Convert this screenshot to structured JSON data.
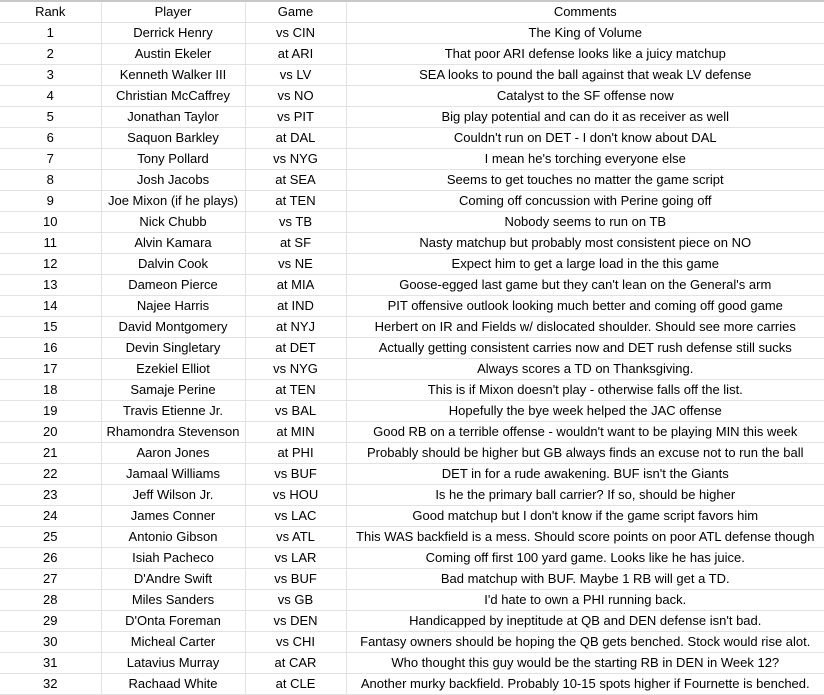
{
  "table": {
    "headers": {
      "rank": "Rank",
      "player": "Player",
      "game": "Game",
      "comments": "Comments"
    },
    "rows": [
      {
        "rank": "1",
        "player": "Derrick Henry",
        "game": "vs CIN",
        "comment": "The King of Volume"
      },
      {
        "rank": "2",
        "player": "Austin Ekeler",
        "game": "at ARI",
        "comment": "That poor ARI defense looks like a juicy matchup"
      },
      {
        "rank": "3",
        "player": "Kenneth Walker III",
        "game": "vs LV",
        "comment": "SEA looks to pound the ball against that weak LV defense"
      },
      {
        "rank": "4",
        "player": "Christian McCaffrey",
        "game": "vs NO",
        "comment": "Catalyst to the SF offense now"
      },
      {
        "rank": "5",
        "player": "Jonathan Taylor",
        "game": "vs PIT",
        "comment": "Big play potential and can do it as receiver as well"
      },
      {
        "rank": "6",
        "player": "Saquon Barkley",
        "game": "at DAL",
        "comment": "Couldn't run on DET - I don't know about DAL"
      },
      {
        "rank": "7",
        "player": "Tony Pollard",
        "game": "vs NYG",
        "comment": "I mean he's torching everyone else"
      },
      {
        "rank": "8",
        "player": "Josh Jacobs",
        "game": "at SEA",
        "comment": "Seems to get touches no matter the game script"
      },
      {
        "rank": "9",
        "player": "Joe Mixon (if he plays)",
        "game": "at TEN",
        "comment": "Coming off concussion with Perine going off"
      },
      {
        "rank": "10",
        "player": "Nick Chubb",
        "game": "vs TB",
        "comment": "Nobody seems to run on TB"
      },
      {
        "rank": "11",
        "player": "Alvin Kamara",
        "game": "at SF",
        "comment": "Nasty matchup but probably most consistent piece on NO"
      },
      {
        "rank": "12",
        "player": "Dalvin Cook",
        "game": "vs NE",
        "comment": "Expect him to get a large load in the this game"
      },
      {
        "rank": "13",
        "player": "Dameon Pierce",
        "game": "at MIA",
        "comment": "Goose-egged last game but they can't lean on the General's arm"
      },
      {
        "rank": "14",
        "player": "Najee Harris",
        "game": "at IND",
        "comment": "PIT offensive outlook looking much better and coming off good game"
      },
      {
        "rank": "15",
        "player": "David Montgomery",
        "game": "at NYJ",
        "comment": "Herbert on IR and Fields w/ dislocated shoulder. Should see more carries"
      },
      {
        "rank": "16",
        "player": "Devin Singletary",
        "game": "at DET",
        "comment": "Actually getting consistent carries now and DET rush defense still sucks"
      },
      {
        "rank": "17",
        "player": "Ezekiel Elliot",
        "game": "vs NYG",
        "comment": "Always scores a TD on Thanksgiving."
      },
      {
        "rank": "18",
        "player": "Samaje Perine",
        "game": "at TEN",
        "comment": "This is if Mixon doesn't play - otherwise falls off the list."
      },
      {
        "rank": "19",
        "player": "Travis Etienne Jr.",
        "game": "vs BAL",
        "comment": "Hopefully the bye week helped the JAC offense"
      },
      {
        "rank": "20",
        "player": "Rhamondra Stevenson",
        "game": "at MIN",
        "comment": "Good RB on a terrible offense - wouldn't want to be playing MIN this week"
      },
      {
        "rank": "21",
        "player": "Aaron Jones",
        "game": "at PHI",
        "comment": "Probably should be higher but GB always finds an excuse not to run the ball"
      },
      {
        "rank": "22",
        "player": "Jamaal Williams",
        "game": "vs BUF",
        "comment": "DET in for a rude awakening. BUF isn't the Giants"
      },
      {
        "rank": "23",
        "player": "Jeff Wilson Jr.",
        "game": "vs HOU",
        "comment": "Is he the primary ball carrier? If so, should be higher"
      },
      {
        "rank": "24",
        "player": "James Conner",
        "game": "vs LAC",
        "comment": "Good matchup but I don't know if the game script favors him"
      },
      {
        "rank": "25",
        "player": "Antonio Gibson",
        "game": "vs ATL",
        "comment": "This WAS backfield is a mess. Should score points on poor ATL defense though"
      },
      {
        "rank": "26",
        "player": "Isiah Pacheco",
        "game": "vs LAR",
        "comment": "Coming off first 100 yard game. Looks like he has juice."
      },
      {
        "rank": "27",
        "player": "D'Andre Swift",
        "game": "vs BUF",
        "comment": "Bad matchup with BUF. Maybe 1 RB will get a TD."
      },
      {
        "rank": "28",
        "player": "Miles Sanders",
        "game": "vs GB",
        "comment": "I'd hate to own a PHI running back."
      },
      {
        "rank": "29",
        "player": "D'Onta Foreman",
        "game": "vs DEN",
        "comment": "Handicapped by ineptitude at QB and DEN defense isn't bad."
      },
      {
        "rank": "30",
        "player": "Micheal Carter",
        "game": "vs CHI",
        "comment": "Fantasy owners should be hoping the QB gets benched. Stock would rise alot."
      },
      {
        "rank": "31",
        "player": "Latavius Murray",
        "game": "at CAR",
        "comment": "Who thought this guy would be the starting RB in DEN in Week 12?"
      },
      {
        "rank": "32",
        "player": "Rachaad White",
        "game": "at CLE",
        "comment": "Another murky backfield. Probably 10-15 spots higher if Fournette is benched."
      }
    ]
  }
}
